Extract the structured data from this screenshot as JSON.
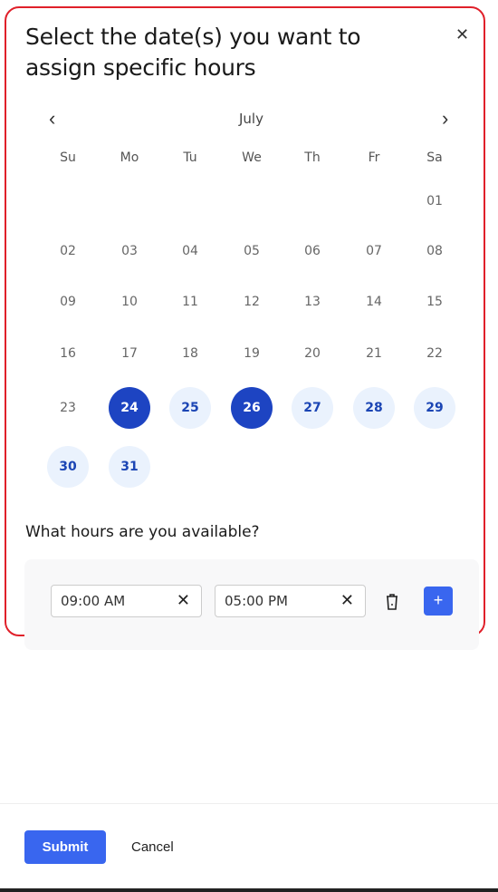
{
  "dialog": {
    "title": "Select the date(s) you want to assign specific hours",
    "close_icon": "close-icon"
  },
  "calendar": {
    "month": "July",
    "prev_icon": "chevron-left-icon",
    "next_icon": "chevron-right-icon",
    "weekdays": [
      "Su",
      "Mo",
      "Tu",
      "We",
      "Th",
      "Fr",
      "Sa"
    ],
    "first_weekday_index": 6,
    "days": [
      {
        "label": "01",
        "state": "default"
      },
      {
        "label": "02",
        "state": "default"
      },
      {
        "label": "03",
        "state": "default"
      },
      {
        "label": "04",
        "state": "default"
      },
      {
        "label": "05",
        "state": "default"
      },
      {
        "label": "06",
        "state": "default"
      },
      {
        "label": "07",
        "state": "default"
      },
      {
        "label": "08",
        "state": "default"
      },
      {
        "label": "09",
        "state": "default"
      },
      {
        "label": "10",
        "state": "default"
      },
      {
        "label": "11",
        "state": "default"
      },
      {
        "label": "12",
        "state": "default"
      },
      {
        "label": "13",
        "state": "default"
      },
      {
        "label": "14",
        "state": "default"
      },
      {
        "label": "15",
        "state": "default"
      },
      {
        "label": "16",
        "state": "default"
      },
      {
        "label": "17",
        "state": "default"
      },
      {
        "label": "18",
        "state": "default"
      },
      {
        "label": "19",
        "state": "default"
      },
      {
        "label": "20",
        "state": "default"
      },
      {
        "label": "21",
        "state": "default"
      },
      {
        "label": "22",
        "state": "default"
      },
      {
        "label": "23",
        "state": "default"
      },
      {
        "label": "24",
        "state": "selected"
      },
      {
        "label": "25",
        "state": "available"
      },
      {
        "label": "26",
        "state": "selected"
      },
      {
        "label": "27",
        "state": "available"
      },
      {
        "label": "28",
        "state": "available"
      },
      {
        "label": "29",
        "state": "available"
      },
      {
        "label": "30",
        "state": "available"
      },
      {
        "label": "31",
        "state": "available"
      }
    ],
    "colors": {
      "selected": "#1d44c2",
      "available": "#eaf2fd"
    }
  },
  "hours": {
    "question": "What hours are you available?",
    "start_value": "09:00 AM",
    "end_value": "05:00 PM",
    "clear_symbol": "✕",
    "add_symbol": "+"
  },
  "footer": {
    "submit_label": "Submit",
    "cancel_label": "Cancel",
    "accent": "#3966ef"
  }
}
